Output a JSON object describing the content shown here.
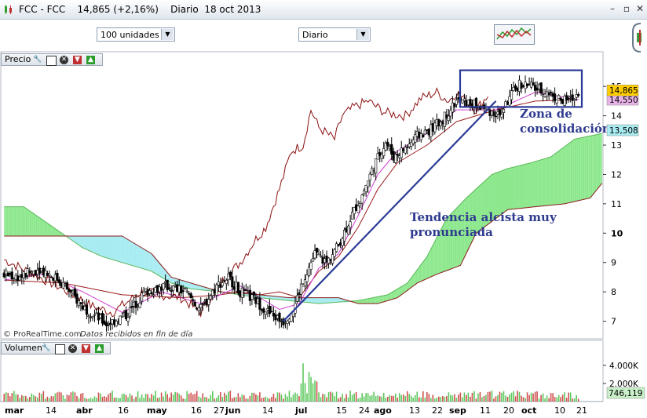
{
  "window": {
    "title": "FCC - FCC",
    "price_change": "14,865 (+2,16%)",
    "period": "Diario",
    "date": "18 oct 2013"
  },
  "toolbar": {
    "units": "100 unidades",
    "interval": "Diario"
  },
  "panels": {
    "price_label": "Precio",
    "volume_label": "Volumen"
  },
  "colors": {
    "price_tag": "#ffcc00",
    "kijun_tag": "#e8b4e8",
    "cloud_tag": "#a8ecf2",
    "trend_line": "#2a3a96",
    "annotation_text": "#2e3b8f",
    "box": "#2a3a96"
  },
  "chart_data": {
    "type": "candlestick",
    "symbol": "FCC",
    "currency_price": 14.865,
    "price_label": "14,865",
    "kijun_label": "14,550",
    "cloud_label": "13,508",
    "volume_label": "746,119",
    "ylim": [
      6.4,
      15.7
    ],
    "y_ticks": [
      "7",
      "8",
      "9",
      "10",
      "11",
      "12",
      "13",
      "14",
      "15"
    ],
    "volume_ticks": [
      "2.000K",
      "4.000K"
    ],
    "volume_ylim": [
      0,
      5200
    ],
    "x_tick_labels": [
      "mar",
      "14",
      "abr",
      "16",
      "may",
      "16",
      "27",
      "jun",
      "14",
      "jul",
      "15",
      "24",
      "ago",
      "13",
      "22",
      "sep",
      "11",
      "20",
      "oct",
      "10",
      "21"
    ],
    "annotations": {
      "consolidation": [
        "Zona de",
        "consolidación"
      ],
      "trend": [
        "Tendencia alcista muy",
        "pronunciada"
      ]
    },
    "watermark": "© ProRealTime.com",
    "footnote": "Datos recibidos en fin de día",
    "close_anchors": [
      [
        0,
        8.6
      ],
      [
        8,
        8.5
      ],
      [
        18,
        8.8
      ],
      [
        28,
        8.4
      ],
      [
        40,
        7.5
      ],
      [
        52,
        6.9
      ],
      [
        62,
        7.2
      ],
      [
        72,
        8.0
      ],
      [
        82,
        8.2
      ],
      [
        92,
        8.0
      ],
      [
        100,
        7.4
      ],
      [
        108,
        8.2
      ],
      [
        114,
        8.5
      ],
      [
        120,
        8.0
      ],
      [
        128,
        7.7
      ],
      [
        136,
        7.2
      ],
      [
        142,
        7.0
      ],
      [
        147,
        7.4
      ],
      [
        152,
        8.4
      ],
      [
        158,
        9.3
      ],
      [
        164,
        9.0
      ],
      [
        170,
        9.6
      ],
      [
        176,
        10.5
      ],
      [
        182,
        11.3
      ],
      [
        188,
        12.3
      ],
      [
        194,
        13.1
      ],
      [
        198,
        12.6
      ],
      [
        204,
        12.9
      ],
      [
        210,
        13.3
      ],
      [
        216,
        13.5
      ],
      [
        222,
        13.8
      ],
      [
        230,
        14.5
      ],
      [
        238,
        14.4
      ],
      [
        246,
        14.2
      ],
      [
        252,
        14.0
      ],
      [
        256,
        14.5
      ],
      [
        262,
        15.1
      ],
      [
        268,
        15.0
      ],
      [
        276,
        14.8
      ],
      [
        284,
        14.5
      ],
      [
        290,
        14.6
      ],
      [
        292,
        14.86
      ]
    ],
    "tenkan_anchors": [
      [
        0,
        8.4
      ],
      [
        20,
        8.6
      ],
      [
        40,
        8.0
      ],
      [
        60,
        7.3
      ],
      [
        80,
        8.0
      ],
      [
        100,
        7.6
      ],
      [
        120,
        8.2
      ],
      [
        140,
        7.4
      ],
      [
        150,
        7.6
      ],
      [
        160,
        8.8
      ],
      [
        170,
        9.3
      ],
      [
        180,
        10.6
      ],
      [
        190,
        12.0
      ],
      [
        200,
        12.8
      ],
      [
        215,
        13.4
      ],
      [
        230,
        14.2
      ],
      [
        250,
        14.2
      ],
      [
        270,
        14.8
      ],
      [
        292,
        14.55
      ]
    ],
    "chikou_anchors": [
      [
        0,
        9.1
      ],
      [
        15,
        8.6
      ],
      [
        30,
        8.1
      ],
      [
        45,
        7.5
      ],
      [
        55,
        7.3
      ],
      [
        70,
        8.0
      ],
      [
        90,
        7.8
      ],
      [
        100,
        7.3
      ],
      [
        110,
        8.3
      ],
      [
        120,
        9.0
      ],
      [
        128,
        9.8
      ],
      [
        133,
        10.2
      ],
      [
        140,
        11.5
      ],
      [
        146,
        12.8
      ],
      [
        152,
        13.0
      ],
      [
        156,
        14.2
      ],
      [
        160,
        13.6
      ],
      [
        168,
        13.2
      ],
      [
        172,
        14.0
      ],
      [
        178,
        14.3
      ],
      [
        185,
        14.5
      ],
      [
        194,
        14.1
      ],
      [
        204,
        14.0
      ],
      [
        212,
        14.6
      ],
      [
        220,
        14.8
      ],
      [
        226,
        14.5
      ],
      [
        230,
        14.8
      ],
      [
        240,
        14.2
      ],
      [
        246,
        14.7
      ]
    ],
    "kijun_anchors": [
      [
        0,
        8.4
      ],
      [
        30,
        8.3
      ],
      [
        60,
        7.9
      ],
      [
        90,
        7.8
      ],
      [
        110,
        7.9
      ],
      [
        120,
        8.0
      ],
      [
        130,
        7.9
      ],
      [
        140,
        8.0
      ],
      [
        150,
        7.8
      ],
      [
        160,
        8.7
      ],
      [
        170,
        9.2
      ],
      [
        180,
        10.2
      ],
      [
        190,
        11.5
      ],
      [
        200,
        12.4
      ],
      [
        215,
        13.0
      ],
      [
        230,
        13.8
      ],
      [
        250,
        14.2
      ],
      [
        270,
        14.5
      ],
      [
        292,
        14.55
      ]
    ],
    "cloud_a_anchors": [
      [
        0,
        10.9
      ],
      [
        10,
        10.9
      ],
      [
        25,
        10.2
      ],
      [
        40,
        9.5
      ],
      [
        50,
        9.2
      ],
      [
        60,
        9.0
      ],
      [
        75,
        8.7
      ],
      [
        85,
        8.3
      ],
      [
        95,
        8.1
      ],
      [
        110,
        8.0
      ],
      [
        130,
        7.8
      ],
      [
        145,
        7.7
      ],
      [
        160,
        7.6
      ],
      [
        180,
        7.7
      ],
      [
        195,
        7.9
      ],
      [
        205,
        8.3
      ],
      [
        215,
        9.2
      ],
      [
        225,
        10.5
      ],
      [
        235,
        11.2
      ],
      [
        248,
        12.0
      ],
      [
        256,
        12.2
      ],
      [
        268,
        12.4
      ],
      [
        278,
        12.6
      ],
      [
        290,
        13.2
      ],
      [
        304,
        13.4
      ]
    ],
    "cloud_b_anchors": [
      [
        0,
        9.9
      ],
      [
        60,
        9.9
      ],
      [
        75,
        9.3
      ],
      [
        85,
        8.5
      ],
      [
        95,
        8.3
      ],
      [
        110,
        8.0
      ],
      [
        130,
        7.9
      ],
      [
        145,
        7.8
      ],
      [
        160,
        7.8
      ],
      [
        170,
        7.8
      ],
      [
        180,
        7.6
      ],
      [
        190,
        7.6
      ],
      [
        200,
        7.8
      ],
      [
        210,
        8.3
      ],
      [
        220,
        8.6
      ],
      [
        232,
        8.9
      ],
      [
        240,
        10.0
      ],
      [
        256,
        10.8
      ],
      [
        270,
        10.9
      ],
      [
        285,
        11.0
      ],
      [
        298,
        11.2
      ],
      [
        304,
        11.7
      ]
    ]
  }
}
